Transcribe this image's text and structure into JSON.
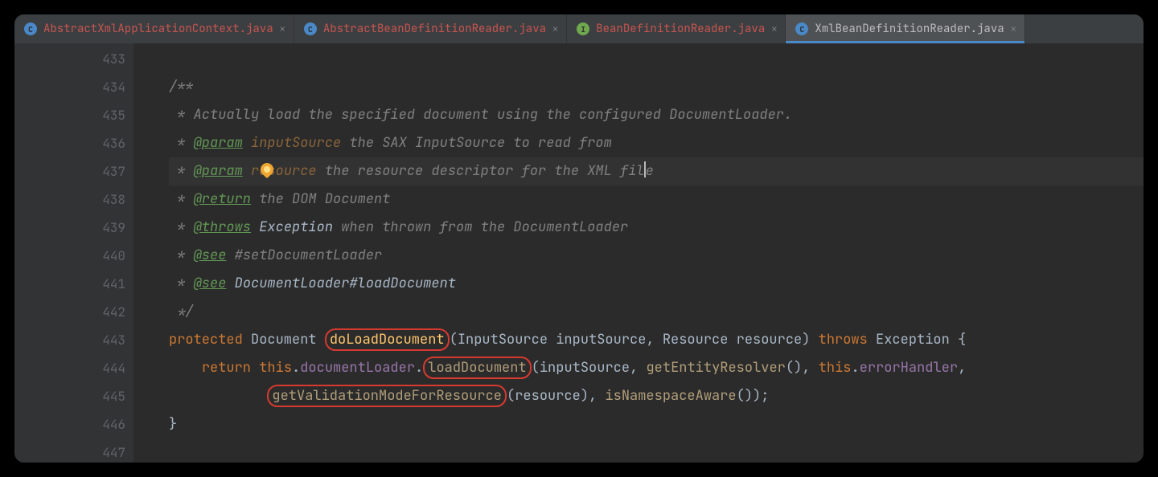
{
  "tabs": [
    {
      "label": "AbstractXmlApplicationContext.java",
      "icon": "C",
      "iconKind": "c",
      "active": false
    },
    {
      "label": "AbstractBeanDefinitionReader.java",
      "icon": "C",
      "iconKind": "c",
      "active": false
    },
    {
      "label": "BeanDefinitionReader.java",
      "icon": "I",
      "iconKind": "i",
      "active": false
    },
    {
      "label": "XmlBeanDefinitionReader.java",
      "icon": "C",
      "iconKind": "c",
      "active": true
    }
  ],
  "gutter": {
    "lines": [
      433,
      434,
      435,
      436,
      437,
      438,
      439,
      440,
      441,
      442,
      443,
      444,
      445,
      446,
      447
    ],
    "bulbAt": 437,
    "folds": {
      "434": "minus",
      "442": "end",
      "443": "minus",
      "446": "end"
    }
  },
  "code": {
    "l433": "",
    "l434a": "/**",
    "l435a": " * Actually load the specified document using the configured DocumentLoader.",
    "l436a": " * ",
    "l436b": "@param",
    "l436c": " ",
    "l436d": "inputSource",
    "l436e": " the SAX InputSource to read from",
    "l437a": " * ",
    "l437b": "@param",
    "l437c": " ",
    "l437d": "resource",
    "l437e": " the resource descriptor for the XML fil",
    "l437f": "e",
    "l438a": " * ",
    "l438b": "@return",
    "l438c": " the DOM Document",
    "l439a": " * ",
    "l439b": "@throws",
    "l439c": " Exception",
    "l439d": " when thrown from the DocumentLoader",
    "l440a": " * ",
    "l440b": "@see",
    "l440c": " #setDocumentLoader",
    "l441a": " * ",
    "l441b": "@see",
    "l441c": " DocumentLoader#loadDocument",
    "l442a": " */",
    "l443a": "protected",
    "l443b": " Document ",
    "l443c": "doLoadDocument",
    "l443d": "(InputSource inputSource, Resource resource) ",
    "l443e": "throws",
    "l443f": " Exception {",
    "l444a": "    ",
    "l444b": "return",
    "l444c": " ",
    "l444d": "this",
    "l444e": ".",
    "l444f": "documentLoader",
    "l444g": ".",
    "l444h": "loadDocument",
    "l444i": "(inputSource, ",
    "l444j": "getEntityResolver",
    "l444k": "(), ",
    "l444l": "this",
    "l444m": ".",
    "l444n": "errorHandler",
    "l444o": ",",
    "l445a": "            ",
    "l445b": "getValidationModeForResource",
    "l445c": "(resource), ",
    "l445d": "isNamespaceAware",
    "l445e": "());",
    "l446a": "}"
  }
}
